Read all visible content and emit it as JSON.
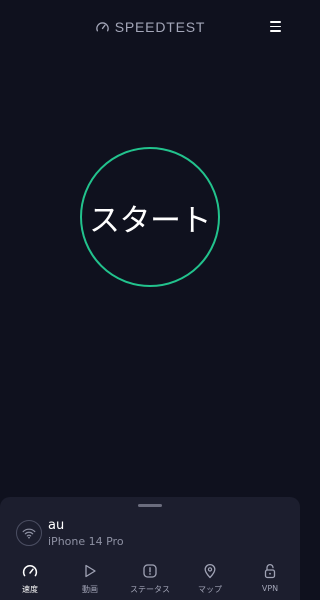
{
  "header": {
    "brand": "SPEEDTEST",
    "brand_icon": "speedometer-icon",
    "menu_icon": "hamburger-menu-icon"
  },
  "start": {
    "label": "スタート",
    "ring_color": "#22c38d"
  },
  "connection": {
    "provider": "au",
    "device": "iPhone 14 Pro",
    "icon": "wifi-icon"
  },
  "tabs": [
    {
      "label": "速度",
      "icon": "speedometer-icon",
      "active": true
    },
    {
      "label": "動画",
      "icon": "play-icon",
      "active": false
    },
    {
      "label": "ステータス",
      "icon": "alert-icon",
      "active": false
    },
    {
      "label": "マップ",
      "icon": "map-pin-icon",
      "active": false
    },
    {
      "label": "VPN",
      "icon": "lock-icon",
      "active": false
    }
  ],
  "colors": {
    "background": "#0f111e",
    "sheet": "#1c1e2e",
    "accent": "#22c38d"
  }
}
